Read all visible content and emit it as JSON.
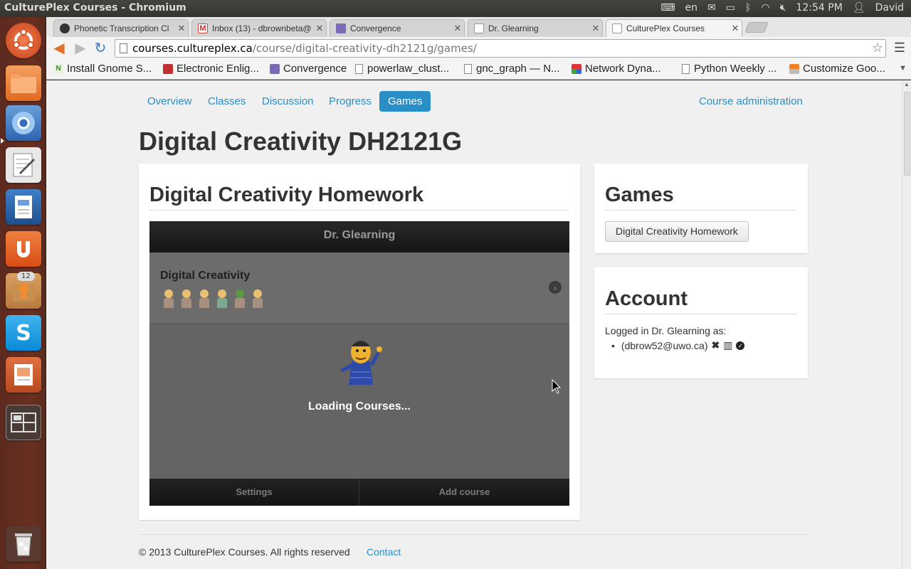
{
  "system": {
    "window_title": "CulturePlex Courses - Chromium",
    "keyboard_layout": "en",
    "clock": "12:54 PM",
    "user": "David",
    "launcher_badge": "12"
  },
  "browser": {
    "tabs": [
      {
        "label": "Phonetic Transcription Cl",
        "icon": "github-icon"
      },
      {
        "label": "Inbox (13) - dbrownbeta@",
        "icon": "gmail-icon"
      },
      {
        "label": "Convergence",
        "icon": "convergence-icon"
      },
      {
        "label": "Dr. Glearning",
        "icon": "page-icon"
      },
      {
        "label": "CulturePlex Courses",
        "icon": "page-icon",
        "active": true
      }
    ],
    "url_host": "courses.cultureplex.ca",
    "url_path": "/course/digital-creativity-dh2121g/games/",
    "bookmarks": [
      {
        "label": "Install Gnome S...",
        "icon": "gnome-icon"
      },
      {
        "label": "Electronic Enlig...",
        "icon": "ee-icon"
      },
      {
        "label": "Convergence",
        "icon": "convergence-icon"
      },
      {
        "label": "powerlaw_clust...",
        "icon": "doc-icon"
      },
      {
        "label": "gnc_graph — N...",
        "icon": "doc-icon"
      },
      {
        "label": "Network Dyna...",
        "icon": "network-icon"
      },
      {
        "label": "Python Weekly ...",
        "icon": "doc-icon"
      },
      {
        "label": "Customize Goo...",
        "icon": "stackoverflow-icon"
      }
    ]
  },
  "nav": {
    "items": [
      "Overview",
      "Classes",
      "Discussion",
      "Progress",
      "Games"
    ],
    "active": "Games",
    "admin_link": "Course administration"
  },
  "course_title": "Digital Creativity DH2121G",
  "main_panel": {
    "heading": "Digital Creativity Homework",
    "game": {
      "header": "Dr. Glearning",
      "row_title": "Digital Creativity",
      "loading_text": "Loading Courses...",
      "footer_left": "Settings",
      "footer_right": "Add course"
    }
  },
  "games_panel": {
    "heading": "Games",
    "button_label": "Digital Creativity Homework"
  },
  "account_panel": {
    "heading": "Account",
    "logged_text": "Logged in Dr. Glearning as:",
    "identity": "(dbrow52@uwo.ca)"
  },
  "footer": {
    "copyright": "© 2013 CulturePlex Courses. All rights reserved",
    "contact": "Contact"
  },
  "colors": {
    "accent": "#2a8fc7",
    "launcher": "#6a3020",
    "panel_bg": "#3c3b37"
  }
}
